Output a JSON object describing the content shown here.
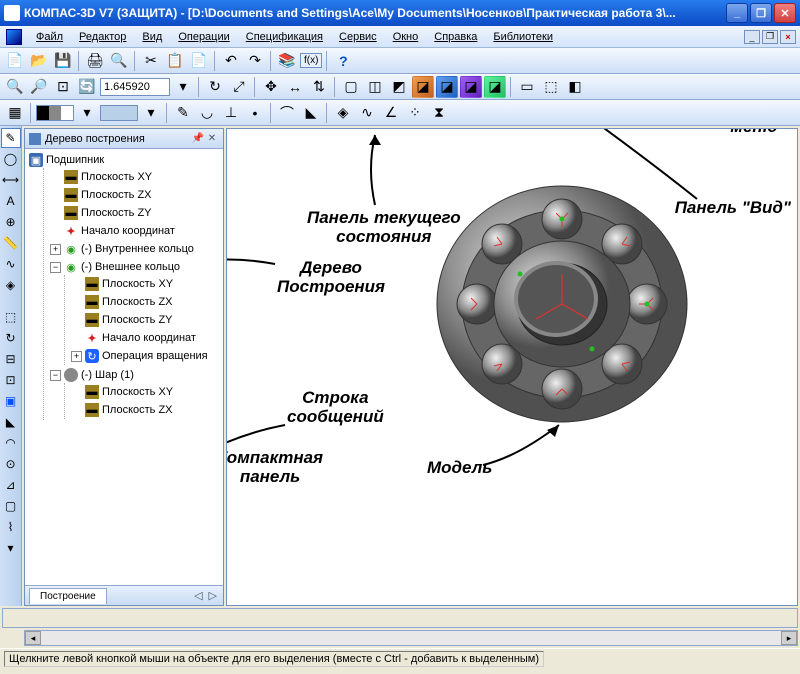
{
  "window": {
    "title": "КОМПАС-3D V7 (ЗАЩИТА) - [D:\\Documents and Settings\\Ace\\My Documents\\Носенков\\Практическая работа 3\\..."
  },
  "menu": {
    "items": [
      "Файл",
      "Редактор",
      "Вид",
      "Операции",
      "Спецификация",
      "Сервис",
      "Окно",
      "Справка",
      "Библиотеки"
    ]
  },
  "toolbar2": {
    "zoom_value": "1.645920"
  },
  "tree": {
    "title": "Дерево построения",
    "root": "Подшипник",
    "plane_xy": "Плоскость XY",
    "plane_zx": "Плоскость ZX",
    "plane_zy": "Плоскость ZY",
    "origin": "Начало координат",
    "inner_ring": "(-) Внутреннее кольцо",
    "outer_ring": "(-) Внешнее кольцо",
    "rotation_op": "Операция вращения",
    "ball": "(-) Шар (1)",
    "tab": "Построение"
  },
  "annotations": {
    "main_menu": "Главное\nменю",
    "view_panel": "Панель \"Вид\"",
    "state_panel": "Панель текущего\nсостояния",
    "build_tree": "Дерево\nПостроения",
    "msg_line": "Строка\nсообщений",
    "compact_panel": "Компактная\nпанель",
    "model": "Модель"
  },
  "status": {
    "text": "Щелкните левой кнопкой мыши на объекте для его выделения (вместе с Ctrl - добавить к выделенным)"
  }
}
